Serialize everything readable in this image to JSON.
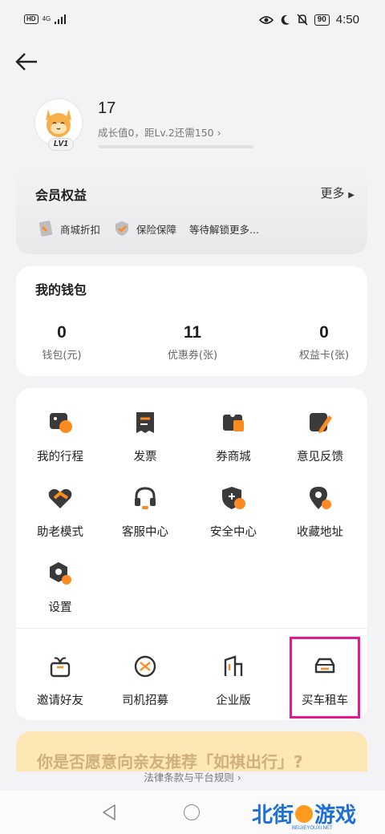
{
  "status_bar": {
    "hd": "HD",
    "network": "4G",
    "battery": "90",
    "time": "4:50"
  },
  "profile": {
    "level_badge": "LV1",
    "username": "17",
    "growth_text": "成长值0，距Lv.2还需150",
    "growth_progress": 0
  },
  "benefits": {
    "title": "会员权益",
    "more": "更多",
    "items": [
      {
        "label": "商城折扣",
        "icon": "coupon-icon"
      },
      {
        "label": "保险保障",
        "icon": "shield-icon"
      },
      {
        "label": "等待解锁更多..."
      }
    ]
  },
  "wallet": {
    "title": "我的钱包",
    "items": [
      {
        "value": "0",
        "label": "钱包(元)"
      },
      {
        "value": "11",
        "label": "优惠券(张)"
      },
      {
        "value": "0",
        "label": "权益卡(张)"
      }
    ]
  },
  "services": {
    "grid": [
      {
        "label": "我的行程",
        "icon": "trip-icon"
      },
      {
        "label": "发票",
        "icon": "invoice-icon"
      },
      {
        "label": "券商城",
        "icon": "coupon-mall-icon"
      },
      {
        "label": "意见反馈",
        "icon": "feedback-icon"
      },
      {
        "label": "助老模式",
        "icon": "elder-care-icon"
      },
      {
        "label": "客服中心",
        "icon": "headset-icon"
      },
      {
        "label": "安全中心",
        "icon": "security-icon"
      },
      {
        "label": "收藏地址",
        "icon": "location-pin-icon"
      },
      {
        "label": "设置",
        "icon": "settings-icon"
      }
    ],
    "extra": [
      {
        "label": "邀请好友",
        "icon": "gift-icon"
      },
      {
        "label": "司机招募",
        "icon": "steering-wheel-icon"
      },
      {
        "label": "企业版",
        "icon": "building-icon"
      },
      {
        "label": "买车租车",
        "icon": "car-icon"
      }
    ]
  },
  "promo": {
    "text": "你是否愿意向亲友推荐「如祺出行」?"
  },
  "footer": {
    "legal": "法律条款与平台规则"
  },
  "watermark": {
    "text_left": "北街",
    "text_right": "游戏",
    "sub": "BEIJIEYOUXI.NET"
  },
  "colors": {
    "accent": "#ff8a1f",
    "highlight": "#e61a8d",
    "icon_dark": "#3a3a3a"
  }
}
